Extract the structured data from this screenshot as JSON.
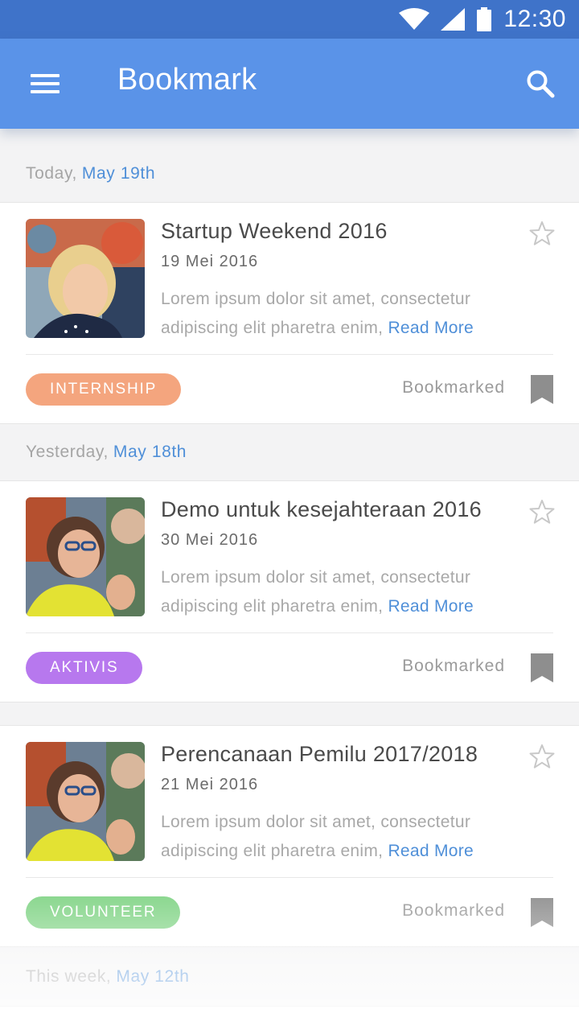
{
  "status_bar": {
    "time": "12:30"
  },
  "app_bar": {
    "title": "Bookmark"
  },
  "sections": [
    {
      "prefix": "Today,",
      "date": "May 19th"
    },
    {
      "prefix": "Yesterday,",
      "date": "May 18th"
    },
    {
      "prefix": "",
      "date": ""
    },
    {
      "prefix": "This week,",
      "date": "May 12th"
    }
  ],
  "cards": [
    {
      "title": "Startup Weekend 2016",
      "date": "19 Mei 2016",
      "body": "Lorem ipsum dolor sit amet, consectetur adipiscing elit pharetra enim,",
      "read_more": "Read More",
      "tag": "INTERNSHIP",
      "tag_color": "#f4a57e",
      "bookmarked_label": "Bookmarked"
    },
    {
      "title": "Demo untuk kesejahteraan 2016",
      "date": "30 Mei 2016",
      "body": "Lorem ipsum dolor sit amet, consectetur adipiscing elit pharetra enim,",
      "read_more": "Read More",
      "tag": "AKTIVIS",
      "tag_color": "#b778ee",
      "bookmarked_label": "Bookmarked"
    },
    {
      "title": "Perencanaan Pemilu 2017/2018",
      "date": "21 Mei 2016",
      "body": "Lorem ipsum dolor sit amet, consectetur adipiscing elit pharetra enim,",
      "read_more": "Read More",
      "tag": "VOLUNTEER",
      "tag_color": "#82d487",
      "bookmarked_label": "Bookmarked"
    }
  ],
  "colors": {
    "status_bar": "#3f73c9",
    "app_bar": "#5a93e8",
    "accent": "#4f8fd8",
    "bookmark_icon": "#8e8e8e"
  },
  "icons": {
    "menu": "hamburger-menu-icon",
    "search": "search-icon",
    "star": "star-outline-icon",
    "bookmark": "bookmark-icon",
    "wifi": "wifi-icon",
    "signal": "signal-icon",
    "battery": "battery-icon"
  }
}
